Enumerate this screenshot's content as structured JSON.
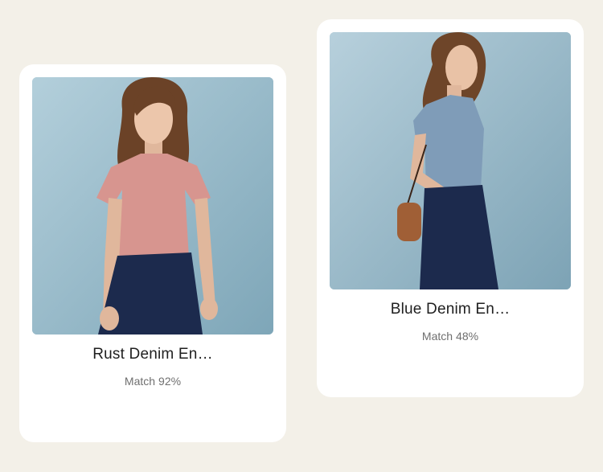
{
  "outfits": [
    {
      "title": "Rust Denim En…",
      "match_label": "Match",
      "match_value": "92%",
      "image_alt": "Woman in pink short-sleeve blouse and navy trousers"
    },
    {
      "title": "Blue Denim En…",
      "match_label": "Match",
      "match_value": "48%",
      "image_alt": "Woman in blue flutter-sleeve top and navy trousers with brown crossbody bag"
    }
  ],
  "colors": {
    "background": "#f3f0e8",
    "card": "#ffffff",
    "photo_backdrop": "#9fbfcc",
    "top_pink": "#d7958f",
    "top_blue": "#7f9cb8",
    "trousers_navy": "#1c2a4d",
    "bag_brown": "#a05f36"
  }
}
